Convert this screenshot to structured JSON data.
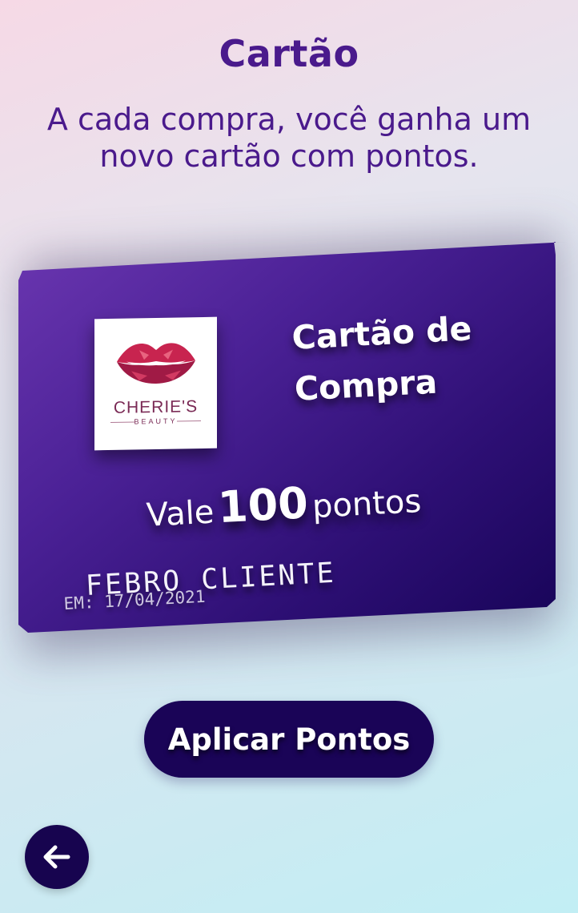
{
  "header": {
    "title": "Cartão",
    "subtitle": "A cada compra, você ganha um novo cartão com pontos."
  },
  "card": {
    "logo": {
      "brand": "CHERIE'S",
      "tagline": "BEAUTY",
      "icon": "lips-icon"
    },
    "heading_line1": "Cartão de",
    "heading_line2": "Compra",
    "points_prefix": "Vale",
    "points_value": "100",
    "points_suffix": "pontos",
    "holder_name": "FEBRO CLIENTE",
    "issued_date": "EM: 17/04/2021",
    "colors": {
      "card_start": "#6a36b0",
      "card_end": "#170458"
    }
  },
  "actions": {
    "apply_label": "Aplicar Pontos",
    "back_icon": "arrow-left-icon"
  },
  "theme": {
    "title_color": "#4a1a8c",
    "button_color": "#1a0457"
  }
}
